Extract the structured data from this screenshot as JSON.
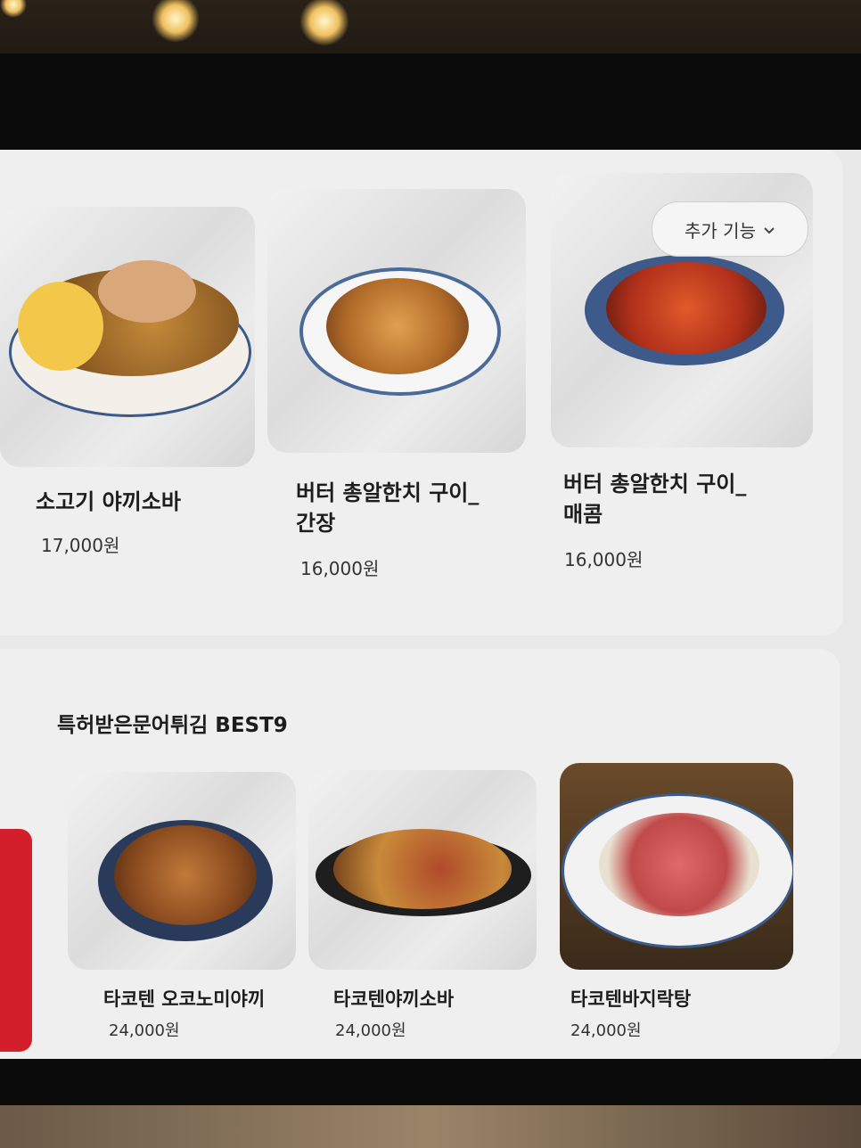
{
  "extra_button": {
    "label": "추가 기능",
    "icon": "chevron-down-icon"
  },
  "menu_top": [
    {
      "name": "소고기 야끼소바",
      "price": "17,000원"
    },
    {
      "name": "버터 총알한치 구이_\n간장",
      "price": "16,000원"
    },
    {
      "name": "버터 총알한치 구이_\n매콤",
      "price": "16,000원"
    }
  ],
  "section": {
    "title": "특허받은문어튀김 BEST9"
  },
  "menu_bottom": [
    {
      "name": "타코텐 오코노미야끼",
      "price": "24,000원"
    },
    {
      "name": "타코텐야끼소바",
      "price": "24,000원"
    },
    {
      "name": "타코텐바지락탕",
      "price": "24,000원"
    }
  ],
  "colors": {
    "accent_red": "#d21f2b",
    "panel_bg": "#efefef",
    "text_dark": "#1d1d1d"
  }
}
